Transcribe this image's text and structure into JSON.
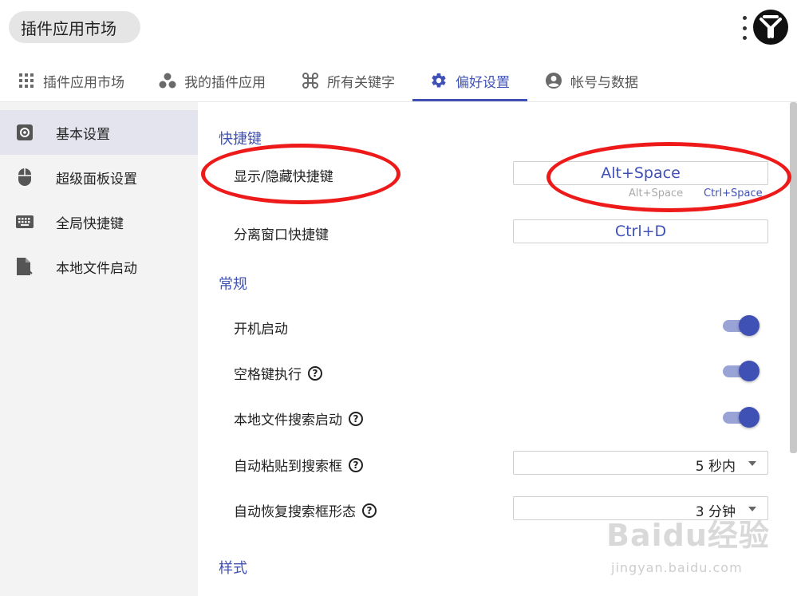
{
  "header": {
    "search_pill": "插件应用市场"
  },
  "tabs": [
    {
      "label": "插件应用市场",
      "icon": "grid-icon"
    },
    {
      "label": "我的插件应用",
      "icon": "dots-cluster-icon"
    },
    {
      "label": "所有关键字",
      "icon": "command-icon"
    },
    {
      "label": "偏好设置",
      "icon": "gear-icon",
      "active": true
    },
    {
      "label": "帐号与数据",
      "icon": "account-icon"
    }
  ],
  "sidebar": {
    "items": [
      {
        "label": "基本设置",
        "icon": "settings-box-icon",
        "active": true
      },
      {
        "label": "超级面板设置",
        "icon": "mouse-icon"
      },
      {
        "label": "全局快捷键",
        "icon": "keyboard-icon"
      },
      {
        "label": "本地文件启动",
        "icon": "file-launch-icon"
      }
    ]
  },
  "main": {
    "shortcut_section": {
      "title": "快捷键",
      "show_hide": {
        "label": "显示/隐藏快捷键",
        "value": "Alt+Space",
        "hint_left": "Alt+Space",
        "hint_right": "Ctrl+Space"
      },
      "detach": {
        "label": "分离窗口快捷键",
        "value": "Ctrl+D"
      }
    },
    "general_section": {
      "title": "常规",
      "startup": {
        "label": "开机启动",
        "on": true
      },
      "space_exec": {
        "label": "空格键执行",
        "on": true
      },
      "local_search": {
        "label": "本地文件搜索启动",
        "on": true
      },
      "auto_paste": {
        "label": "自动粘贴到搜索框",
        "value": "5 秒内"
      },
      "auto_restore": {
        "label": "自动恢复搜索框形态",
        "value": "3 分钟"
      }
    },
    "style_section": {
      "title": "样式"
    }
  },
  "help_glyph": "?",
  "colors": {
    "accent": "#3f51b5",
    "annotation": "#ee1a1a"
  },
  "watermark": {
    "brand": "Baidu经验",
    "url": "jingyan.baidu.com"
  }
}
